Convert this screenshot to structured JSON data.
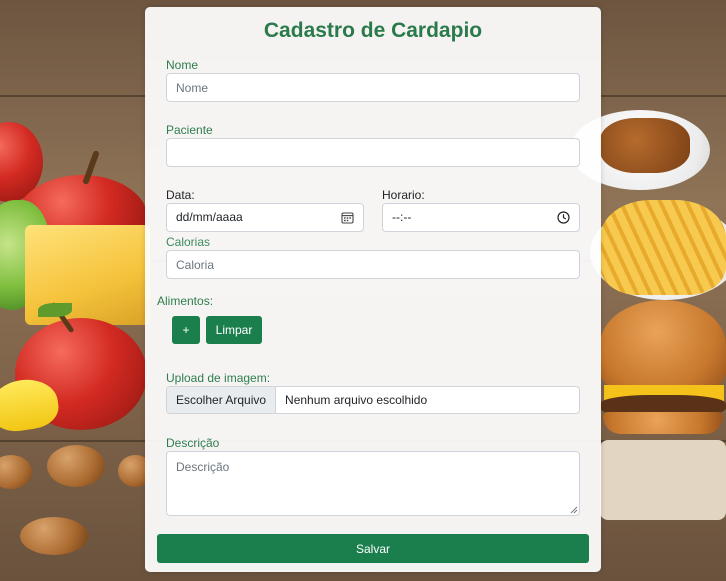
{
  "form": {
    "title": "Cadastro de Cardapio",
    "nome": {
      "label": "Nome",
      "placeholder": "Nome",
      "value": ""
    },
    "paciente": {
      "label": "Paciente",
      "value": ""
    },
    "data": {
      "label": "Data:",
      "display": "dd/mm/aaaa"
    },
    "horario": {
      "label": "Horario:",
      "display": "--:--"
    },
    "calorias": {
      "label": "Calorias",
      "placeholder": "Caloria",
      "value": ""
    },
    "alimentos": {
      "label": "Alimentos:",
      "add_label": "+",
      "clear_label": "Limpar"
    },
    "upload": {
      "label": "Upload de imagem:",
      "button_label": "Escolher Arquivo",
      "status": "Nenhum arquivo escolhido"
    },
    "descricao": {
      "label": "Descrição",
      "placeholder": "Descrição",
      "value": ""
    },
    "submit_label": "Salvar"
  },
  "colors": {
    "accent": "#1b7f4d",
    "title": "#2a7a4b",
    "label": "#2e7d4f"
  },
  "icons": {
    "date": "calendar-icon",
    "time": "clock-icon"
  }
}
